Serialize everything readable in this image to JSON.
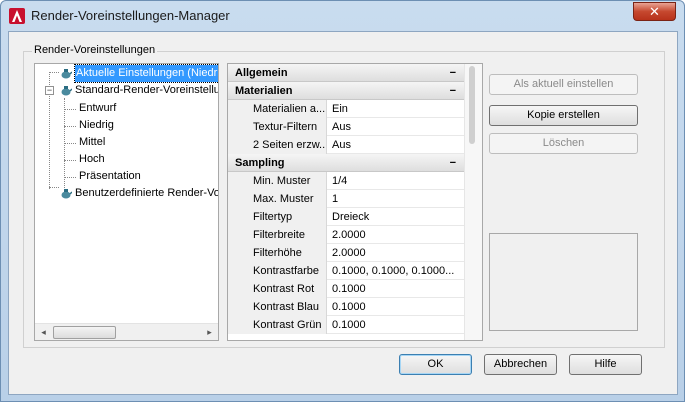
{
  "window": {
    "title": "Render-Voreinstellungen-Manager",
    "close_label": "✕"
  },
  "group": {
    "label": "Render-Voreinstellungen"
  },
  "tree": {
    "items": [
      {
        "label": "Aktuelle Einstellungen (Niedrig",
        "selected": true
      },
      {
        "label": "Standard-Render-Voreinstellu"
      },
      {
        "label": "Entwurf"
      },
      {
        "label": "Niedrig"
      },
      {
        "label": "Mittel"
      },
      {
        "label": "Hoch"
      },
      {
        "label": "Präsentation"
      },
      {
        "label": "Benutzerdefinierte Render-Vo"
      }
    ],
    "scroll_left": "◂",
    "scroll_right": "▸",
    "expander_symbol": "−"
  },
  "properties": {
    "collapse_symbol": "−",
    "sections": [
      {
        "title": "Allgemein",
        "rows": []
      },
      {
        "title": "Materialien",
        "rows": [
          {
            "name": "Materialien a...",
            "value": "Ein"
          },
          {
            "name": "Textur-Filtern",
            "value": "Aus"
          },
          {
            "name": "2 Seiten erzw...",
            "value": "Aus"
          }
        ]
      },
      {
        "title": "Sampling",
        "rows": [
          {
            "name": "Min. Muster",
            "value": "1/4"
          },
          {
            "name": "Max. Muster",
            "value": "1"
          },
          {
            "name": "Filtertyp",
            "value": "Dreieck"
          },
          {
            "name": "Filterbreite",
            "value": "2.0000"
          },
          {
            "name": "Filterhöhe",
            "value": "2.0000"
          },
          {
            "name": "Kontrastfarbe",
            "value": "0.1000, 0.1000, 0.1000..."
          },
          {
            "name": "Kontrast Rot",
            "value": "0.1000"
          },
          {
            "name": "Kontrast Blau",
            "value": "0.1000"
          },
          {
            "name": "Kontrast Grün",
            "value": "0.1000"
          }
        ]
      }
    ]
  },
  "buttons": {
    "set_current": "Als aktuell einstellen",
    "create_copy": "Kopie erstellen",
    "delete": "Löschen",
    "ok": "OK",
    "cancel": "Abbrechen",
    "help": "Hilfe"
  },
  "colors": {
    "selection": "#3399ff",
    "close_button": "#c6482f"
  }
}
